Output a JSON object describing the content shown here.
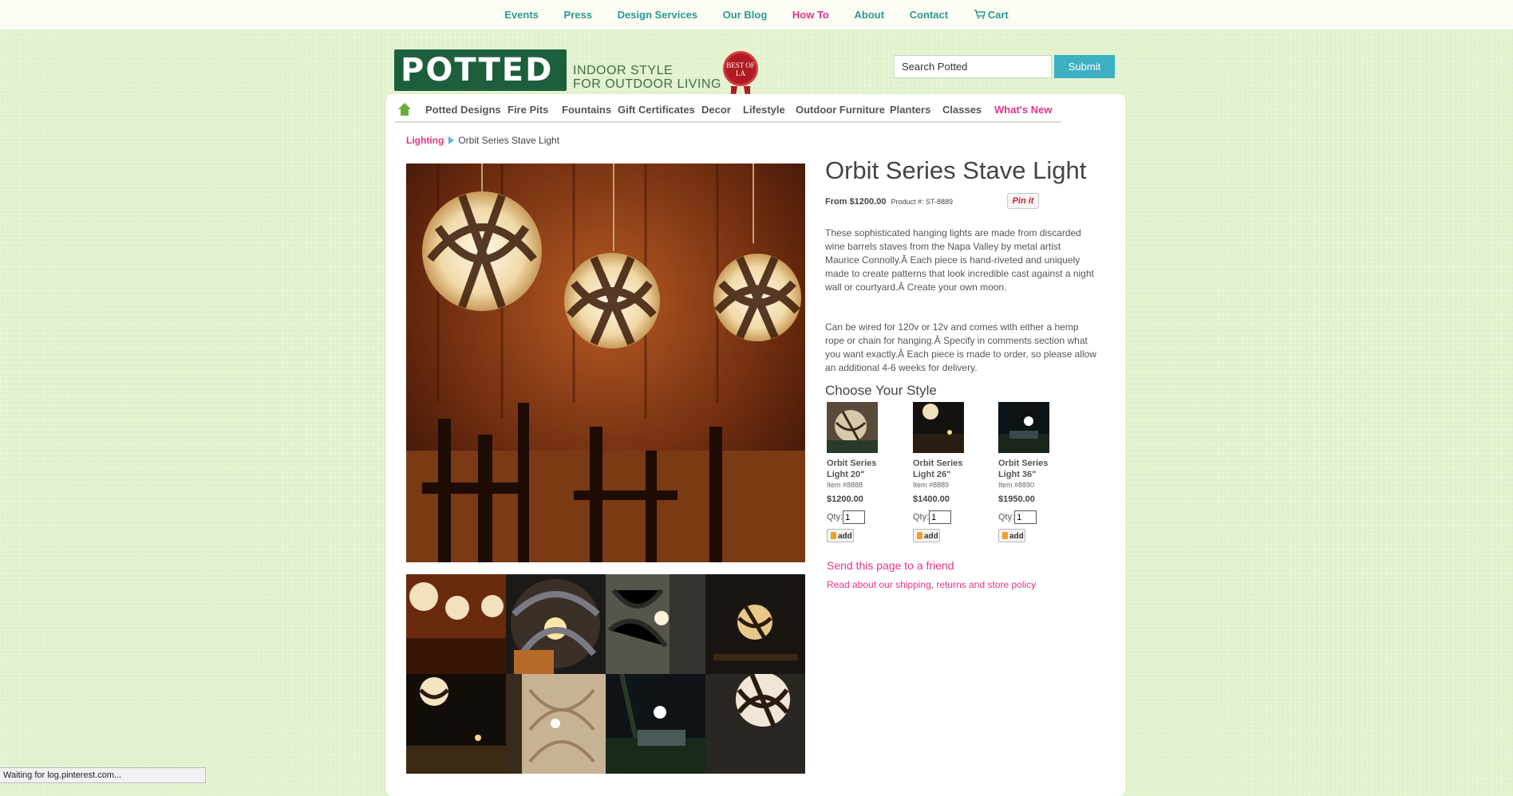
{
  "topnav": {
    "items": [
      {
        "label": "Events"
      },
      {
        "label": "Press"
      },
      {
        "label": "Design Services"
      },
      {
        "label": "Our Blog"
      },
      {
        "label": "How To"
      },
      {
        "label": "About"
      },
      {
        "label": "Contact"
      },
      {
        "label": "Cart"
      }
    ]
  },
  "header": {
    "logo_text": "POTTED",
    "tagline_line1": "INDOOR STYLE",
    "tagline_line2": "FOR OUTDOOR LIVING",
    "seal_text": "BEST OF LA",
    "search_value": "Search Potted",
    "submit_label": "Submit"
  },
  "mainnav": {
    "items": [
      {
        "label": "Potted Designs"
      },
      {
        "label": "Fire Pits"
      },
      {
        "label": "Fountains"
      },
      {
        "label": "Gift Certificates"
      },
      {
        "label": "Decor"
      },
      {
        "label": "Lifestyle"
      },
      {
        "label": "Outdoor Furniture"
      },
      {
        "label": "Planters"
      },
      {
        "label": "Classes"
      },
      {
        "label": "What's New"
      }
    ]
  },
  "breadcrumb": {
    "parent": "Lighting",
    "current": "Orbit Series Stave Light"
  },
  "product": {
    "title": "Orbit Series Stave Light",
    "price_from": "From $1200.00",
    "product_number": "Product #:  ST-8889",
    "pinit_label": "Pin it",
    "description_1": "These sophisticated hanging lights are made from discarded wine barrels staves from the Napa Valley by metal artist Maurice Connolly.Â  Each piece is hand-riveted and uniquely made to create patterns that look incredible cast against a night wall or courtyard.Â  Create your own moon.",
    "description_2": "Can be wired for 120v or 12v and comes with either a hemp rope or chain for hanging.Â  Specify in comments section what you want exactly.Â  Each piece is made to order, so please allow an additional 4-6 weeks for delivery.",
    "style_heading": "Choose Your Style",
    "variants": [
      {
        "name": "Orbit Series Light 20\"",
        "item": "Item #8888",
        "price": "$1200.00",
        "qty_label": "Qty:",
        "qty": "1",
        "add_label": "add"
      },
      {
        "name": "Orbit Series Light 26\"",
        "item": "Item #8889",
        "price": "$1400.00",
        "qty_label": "Qty:",
        "qty": "1",
        "add_label": "add"
      },
      {
        "name": "Orbit Series Light 36\"",
        "item": "Item #8890",
        "price": "$1950.00",
        "qty_label": "Qty:",
        "qty": "1",
        "add_label": "add"
      }
    ],
    "send_friend": "Send this page to a friend",
    "policy_link": "Read about our shipping, returns and store policy"
  },
  "status_bar": "Waiting for log.pinterest.com...",
  "colors": {
    "accent_teal": "#2d9a8f",
    "accent_pink": "#e0348a",
    "submit_blue": "#3cb0c0",
    "logo_green": "#1d5f3c"
  }
}
